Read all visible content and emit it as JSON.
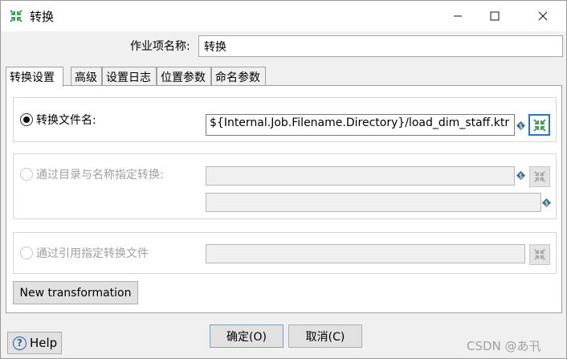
{
  "window": {
    "title": "转换",
    "icon": "transformation-icon"
  },
  "form": {
    "name_label": "作业项名称:",
    "name_value": "转换"
  },
  "tabs": [
    {
      "label": "转换设置",
      "active": true
    },
    {
      "label": "高级"
    },
    {
      "label": "设置日志"
    },
    {
      "label": "位置参数"
    },
    {
      "label": "命名参数"
    }
  ],
  "options": {
    "by_filename": {
      "label": "转换文件名:",
      "value": "${Internal.Job.Filename.Directory}/load_dim_staff.ktr",
      "selected": true
    },
    "by_directory": {
      "label": "通过目录与名称指定转换:",
      "selected": false
    },
    "by_reference": {
      "label": "通过引用指定转换文件",
      "selected": false
    }
  },
  "buttons": {
    "new_transformation": "New transformation",
    "ok": "确定(O)",
    "cancel": "取消(C)",
    "help": "Help"
  },
  "watermark": "CSDN @あ卂",
  "colors": {
    "accent": "#2a76c6",
    "icon_green": "#3aa655",
    "var_icon": "#3a6a8c"
  }
}
